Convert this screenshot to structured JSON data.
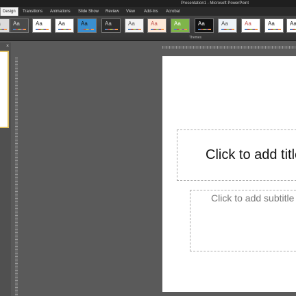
{
  "window": {
    "title": "Presentation1 - Microsoft PowerPoint"
  },
  "tabs": [
    "Design",
    "Transitions",
    "Animations",
    "Slide Show",
    "Review",
    "View",
    "Add-Ins",
    "Acrobat"
  ],
  "ribbon": {
    "group_label": "Themes",
    "theme_glyph": "Aa",
    "themes": [
      {
        "bg": "#dcdcdc",
        "fg": "#333"
      },
      {
        "bg": "#4a4a4a",
        "fg": "#ddd"
      },
      {
        "bg": "#ffffff",
        "fg": "#222"
      },
      {
        "bg": "#ffffff",
        "fg": "#222"
      },
      {
        "bg": "#3a8fd0",
        "fg": "#111"
      },
      {
        "bg": "#2c2c2c",
        "fg": "#ccc"
      },
      {
        "bg": "#f2f2f2",
        "fg": "#555"
      },
      {
        "bg": "#fde9d9",
        "fg": "#c0504d"
      },
      {
        "bg": "#7fb54a",
        "fg": "#fff"
      },
      {
        "bg": "#111111",
        "fg": "#fff"
      },
      {
        "bg": "#eef3f8",
        "fg": "#444"
      },
      {
        "bg": "#ffffff",
        "fg": "#c0504d"
      },
      {
        "bg": "#ffffff",
        "fg": "#222"
      },
      {
        "bg": "#ffffff",
        "fg": "#222"
      }
    ]
  },
  "slide": {
    "title_placeholder": "Click to add title",
    "subtitle_placeholder": "Click to add subtitle"
  },
  "panel": {
    "close_glyph": "×"
  }
}
